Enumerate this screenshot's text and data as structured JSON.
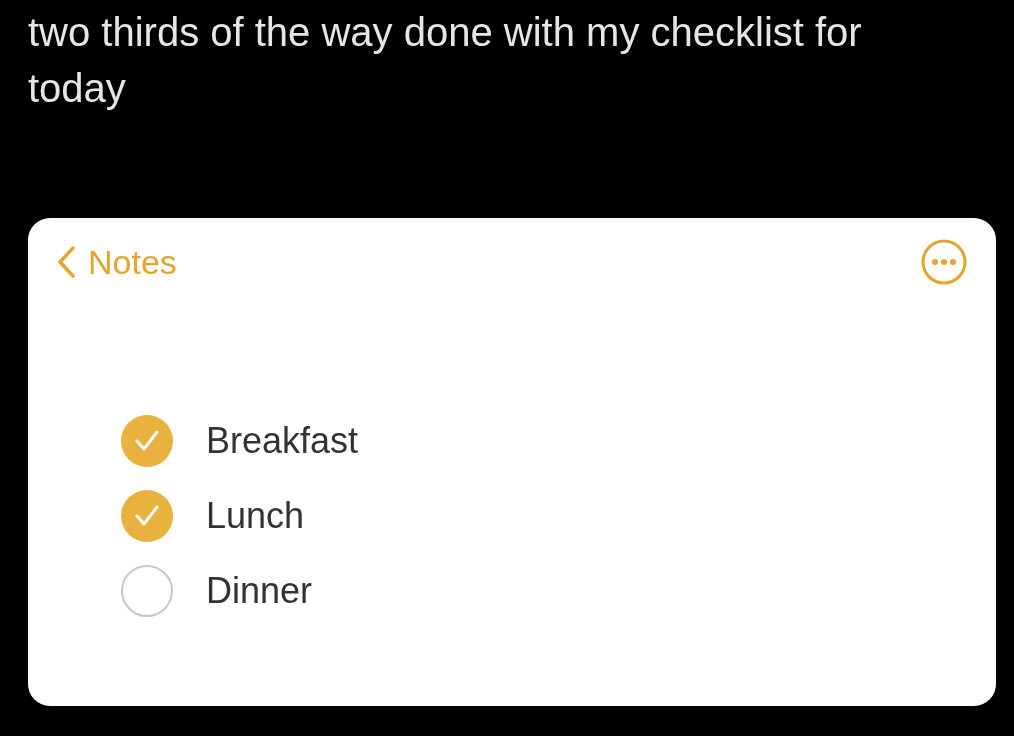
{
  "post": {
    "text": "two thirds of the way done with my checklist for today"
  },
  "note": {
    "back_label": "Notes",
    "checklist": [
      {
        "label": "Breakfast",
        "checked": true
      },
      {
        "label": "Lunch",
        "checked": true
      },
      {
        "label": "Dinner",
        "checked": false
      }
    ]
  }
}
